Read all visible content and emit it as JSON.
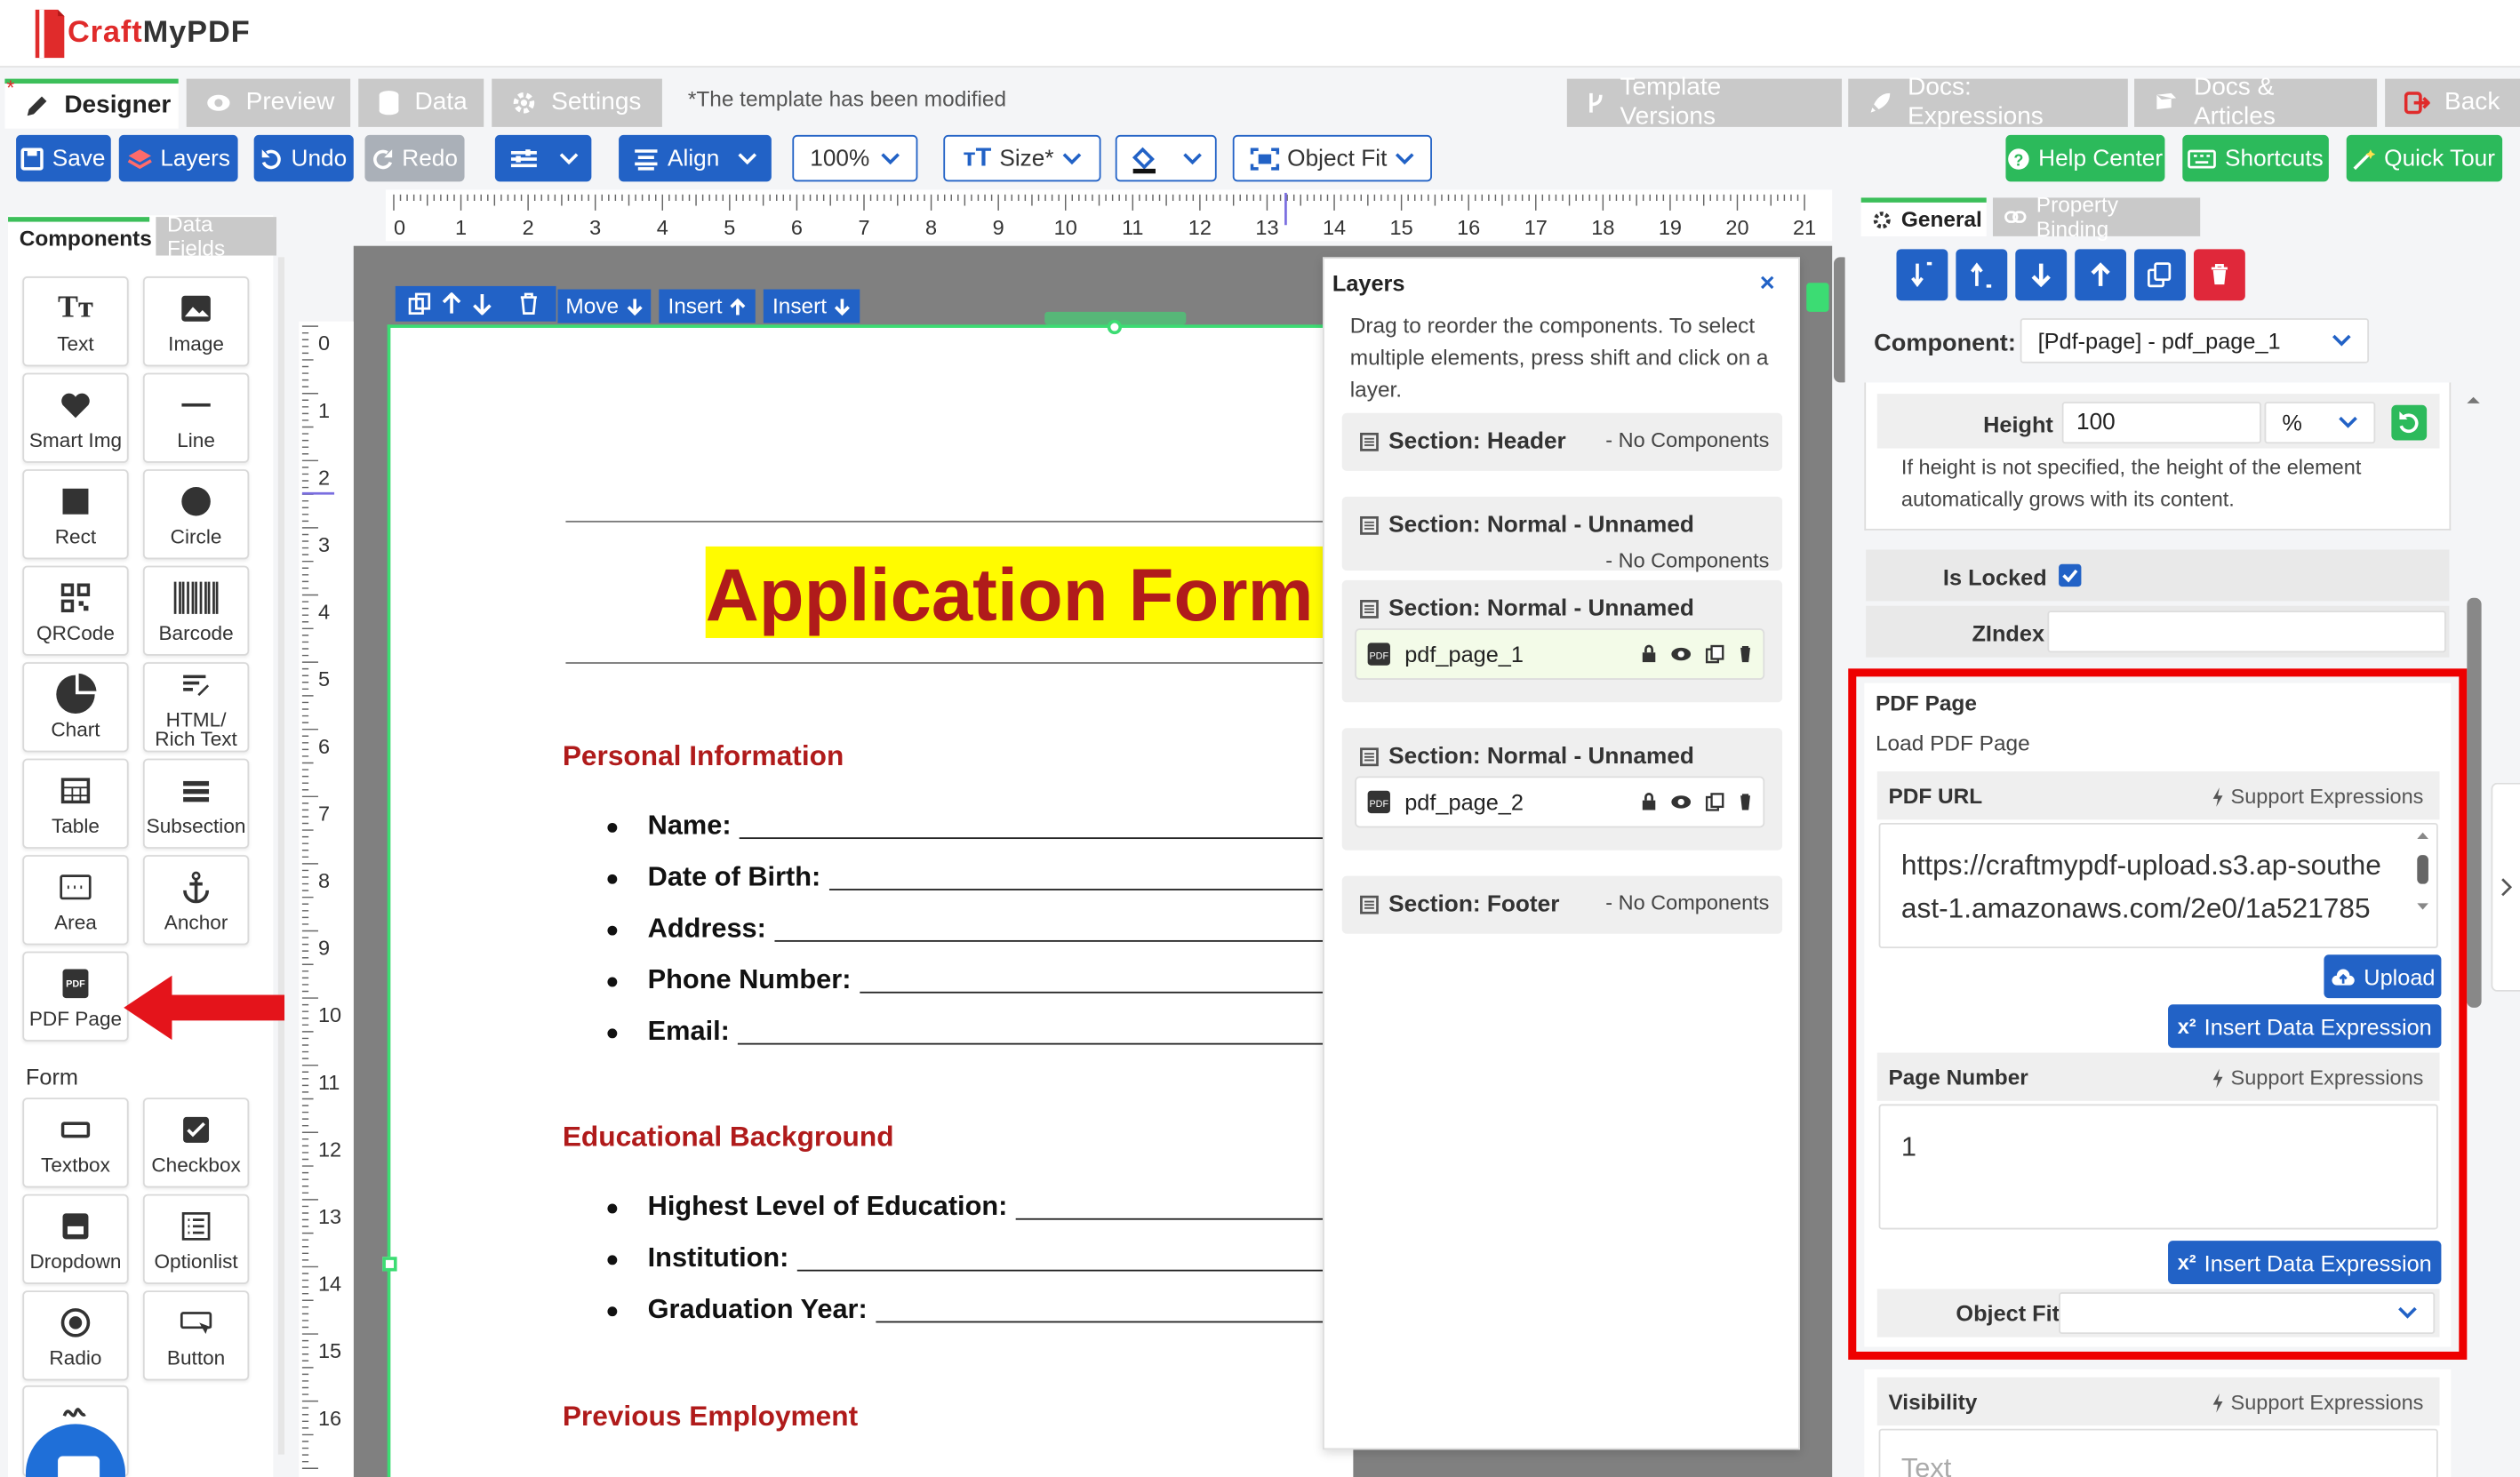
{
  "brand": {
    "name_craft": "Craft",
    "name_rest": "MyPDF"
  },
  "tabs": [
    {
      "label": "Designer",
      "icon": "pencil-icon"
    },
    {
      "label": "Preview",
      "icon": "eye-icon"
    },
    {
      "label": "Data",
      "icon": "database-icon"
    },
    {
      "label": "Settings",
      "icon": "gear-icon"
    }
  ],
  "modified_note": "*The template has been modified",
  "right_tabs": [
    {
      "label": "Template Versions",
      "icon": "branch-icon"
    },
    {
      "label": "Docs: Expressions",
      "icon": "rocket-icon"
    },
    {
      "label": "Docs & Articles",
      "icon": "book-icon"
    },
    {
      "label": "Back",
      "icon": "exit-icon"
    }
  ],
  "toolbar": {
    "save": "Save",
    "layers": "Layers",
    "undo": "Undo",
    "redo": "Redo",
    "align": "Align",
    "zoom": "100%",
    "size": "Size*",
    "object_fit": "Object Fit",
    "help": "Help Center",
    "shortcuts": "Shortcuts",
    "quick_tour": "Quick Tour"
  },
  "left_panel": {
    "tabs": [
      "Components",
      "Data Fields"
    ],
    "components": [
      "Text",
      "Image",
      "Smart Img",
      "Line",
      "Rect",
      "Circle",
      "QRCode",
      "Barcode",
      "Chart",
      "HTML/ Rich Text",
      "Table",
      "Subsection",
      "Area",
      "Anchor",
      "PDF Page"
    ],
    "form_heading": "Form",
    "form": [
      "Textbox",
      "Checkbox",
      "Dropdown",
      "Optionlist",
      "Radio",
      "Button"
    ]
  },
  "ruler": {
    "top": [
      "0",
      "1",
      "2",
      "3",
      "4",
      "5",
      "6",
      "7",
      "8",
      "9",
      "10",
      "11",
      "12",
      "13",
      "14",
      "15",
      "16",
      "17",
      "18",
      "19",
      "20",
      "21"
    ],
    "left": [
      "0",
      "1",
      "2",
      "3",
      "4",
      "5",
      "6",
      "7",
      "8",
      "9",
      "10",
      "11",
      "12",
      "13",
      "14",
      "15",
      "16"
    ]
  },
  "canvas_toolbar": {
    "move": "Move",
    "insert1": "Insert",
    "insert2": "Insert"
  },
  "document": {
    "title": "Application Form",
    "sections": [
      {
        "heading": "Personal Information",
        "items": [
          "Name:",
          "Date of Birth:",
          "Address:",
          "Phone Number:",
          "Email:"
        ]
      },
      {
        "heading": "Educational Background",
        "items": [
          "Highest Level of Education:",
          "Institution:",
          "Graduation Year:"
        ]
      },
      {
        "heading": "Previous Employment",
        "items": []
      }
    ]
  },
  "layers": {
    "title": "Layers",
    "description": "Drag to reorder the components. To select multiple elements, press shift and click on a layer.",
    "sections": [
      {
        "title": "Section: Header",
        "note": "- No Components"
      },
      {
        "title": "Section: Normal - Unnamed",
        "note": "- No Components"
      },
      {
        "title": "Section: Normal - Unnamed",
        "item": "pdf_page_1"
      },
      {
        "title": "Section: Normal - Unnamed",
        "item": "pdf_page_2"
      },
      {
        "title": "Section: Footer",
        "note": "- No Components"
      }
    ]
  },
  "props": {
    "tabs": [
      "General",
      "Property Binding"
    ],
    "component_label": "Component:",
    "component_value": "[Pdf-page] - pdf_page_1",
    "height_label": "Height",
    "height_value": "100",
    "height_unit": "%",
    "height_help": "If height is not specified, the height of the element automatically grows with its content.",
    "locked_label": "Is Locked",
    "zindex_label": "ZIndex",
    "pdf_page_title": "PDF Page",
    "pdf_page_sub": "Load PDF Page",
    "pdf_url_label": "PDF URL",
    "support_expr": "Support Expressions",
    "pdf_url_value": "https://craftmypdf-upload.s3.ap-southeast-1.amazonaws.com/2e0/1a521785",
    "upload": "Upload",
    "insert_expr": "Insert Data Expression",
    "page_number_label": "Page Number",
    "page_number_value": "1",
    "object_fit_label": "Object Fit",
    "visibility_label": "Visibility",
    "visibility_placeholder": "Text"
  },
  "colors": {
    "primary": "#2262c6",
    "green": "#2cba5b",
    "brand": "#e02b2b",
    "highlight": "#ff0000"
  }
}
